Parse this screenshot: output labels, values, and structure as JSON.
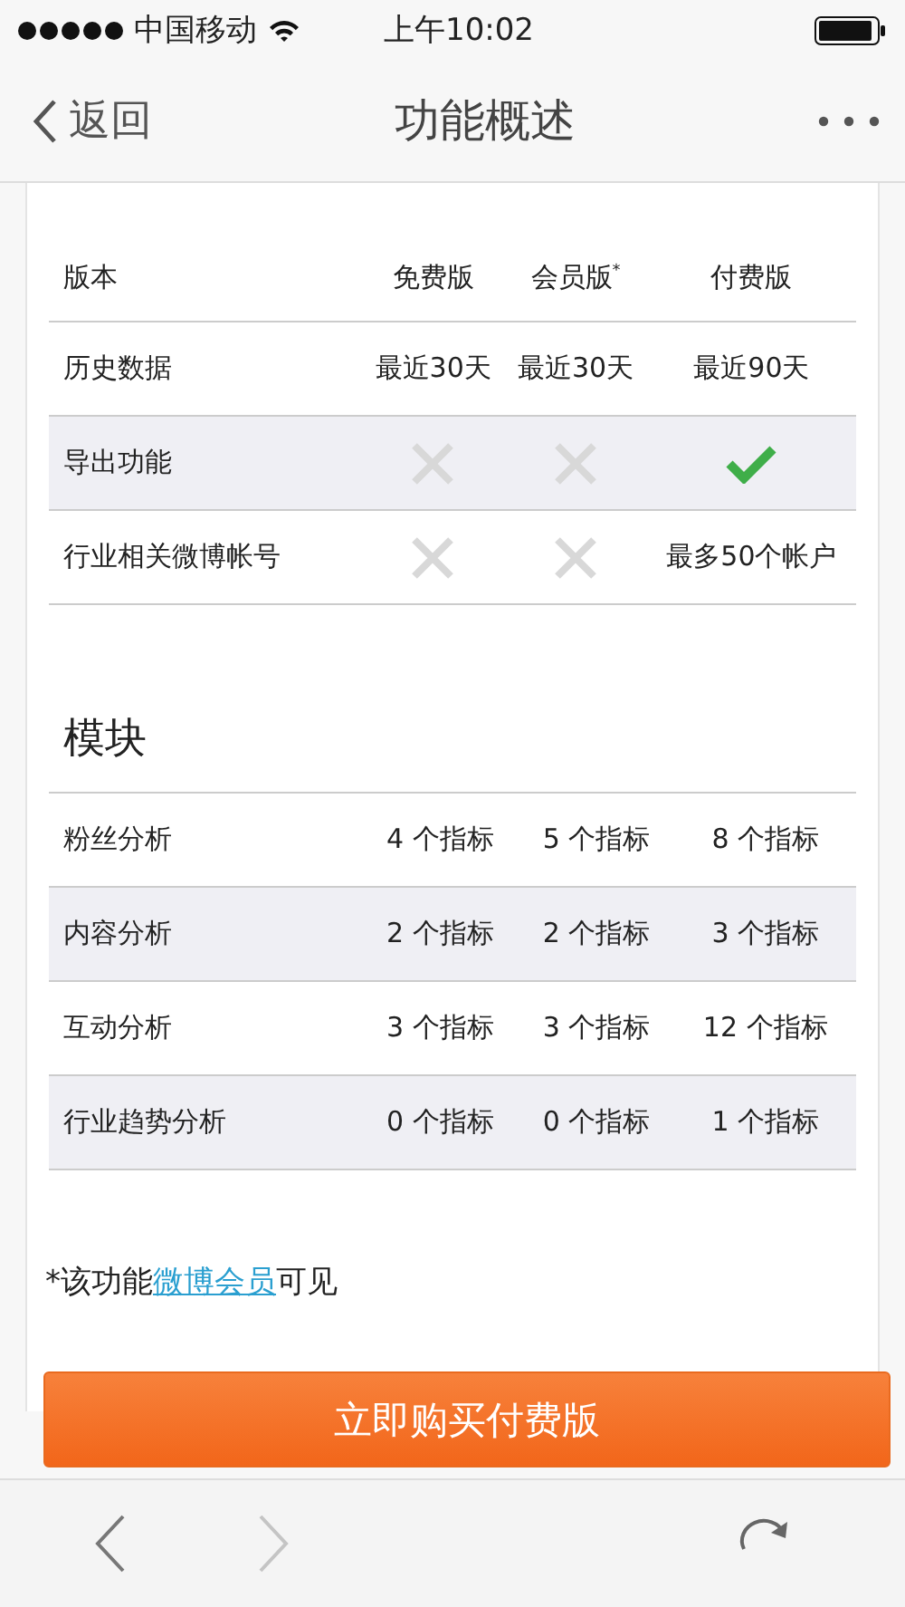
{
  "status_bar": {
    "carrier": "中国移动",
    "time": "上午10:02"
  },
  "nav": {
    "back": "返回",
    "title": "功能概述"
  },
  "versions": {
    "header": [
      {
        "text": "版本"
      },
      {
        "text": "免费版"
      },
      {
        "text": "会员版",
        "note": "*"
      },
      {
        "text": "付费版"
      }
    ],
    "rows": [
      {
        "label": "历史数据",
        "cells": [
          {
            "kind": "text",
            "text": "最近30天"
          },
          {
            "kind": "text",
            "text": "最近30天"
          },
          {
            "kind": "text",
            "text": "最近90天"
          }
        ]
      },
      {
        "label": "导出功能",
        "cells": [
          {
            "kind": "cross"
          },
          {
            "kind": "cross"
          },
          {
            "kind": "check"
          }
        ]
      },
      {
        "label": "行业相关微博帐号",
        "cells": [
          {
            "kind": "cross"
          },
          {
            "kind": "cross"
          },
          {
            "kind": "text",
            "text": "最多50个帐户"
          }
        ]
      }
    ]
  },
  "modules": {
    "title": "模块",
    "rows": [
      {
        "label": "粉丝分析",
        "cells": [
          "4 个指标",
          "5 个指标",
          "8 个指标"
        ]
      },
      {
        "label": "内容分析",
        "cells": [
          "2 个指标",
          "2 个指标",
          "3 个指标"
        ]
      },
      {
        "label": "互动分析",
        "cells": [
          "3 个指标",
          "3 个指标",
          "12 个指标"
        ]
      },
      {
        "label": "行业趋势分析",
        "cells": [
          "0 个指标",
          "0 个指标",
          "1 个指标"
        ]
      }
    ]
  },
  "footnote": {
    "before": "*该功能",
    "link": "微博会员",
    "after": "可见"
  },
  "buy_button": "立即购买付费版",
  "toolbar": {
    "back_disabled": false,
    "forward_disabled": true
  }
}
